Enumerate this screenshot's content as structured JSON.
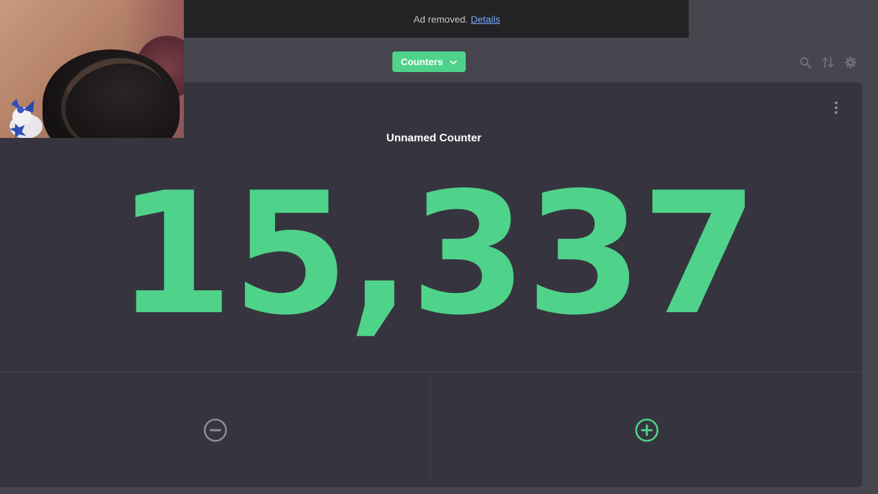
{
  "ad_banner": {
    "text": "Ad removed.",
    "link": "Details"
  },
  "toolbar": {
    "dropdown_label": "Counters",
    "icons": [
      "search-icon",
      "sort-icon",
      "settings-gear-icon"
    ]
  },
  "counter": {
    "name": "Unnamed Counter",
    "value": "15,337"
  },
  "actions": {
    "decrement_icon": "minus-circle-icon",
    "increment_icon": "plus-circle-icon"
  },
  "colors": {
    "accent": "#4fd38a",
    "background": "#47464f",
    "card": "#36353f",
    "ad_banner": "#232325",
    "link": "#7aa9ff",
    "muted_icon": "#8e8d96"
  }
}
